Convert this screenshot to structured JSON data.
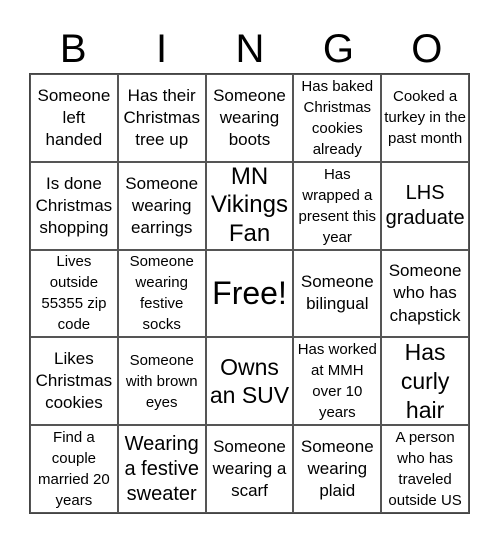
{
  "header": [
    "B",
    "I",
    "N",
    "G",
    "O"
  ],
  "cells": [
    "Someone left handed",
    "Has their Christmas tree up",
    "Someone wearing boots",
    "Has baked Christmas cookies already",
    "Cooked a turkey in the past month",
    "Is done Christmas shopping",
    "Someone wearing earrings",
    "MN Vikings Fan",
    "Has wrapped a present this year",
    "LHS graduate",
    "Lives outside 55355 zip code",
    "Someone wearing festive socks",
    "Free!",
    "Someone bilingual",
    "Someone who has chapstick",
    "Likes Christmas cookies",
    "Someone with brown eyes",
    "Owns an SUV",
    "Has worked at MMH over 10 years",
    "Has curly hair",
    "Find a couple married 20 years",
    "Wearing a festive sweater",
    "Someone wearing a scarf",
    "Someone wearing plaid",
    "A person who has traveled outside US"
  ]
}
